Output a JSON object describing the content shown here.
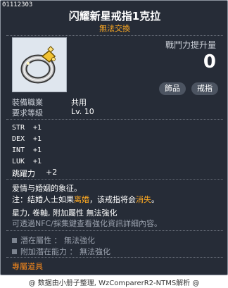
{
  "item": {
    "id": "01112303",
    "name": "闪耀新星戒指1克拉",
    "trade": "無法交換",
    "stat_label": "戰鬥力提升量",
    "stat_value": "0",
    "tags": [
      "飾品",
      "戒指"
    ]
  },
  "requirements": [
    {
      "label": "裝備職業",
      "value": "共用"
    },
    {
      "label": "要求等級",
      "value": "Lv. 10"
    }
  ],
  "stats": [
    {
      "name": "STR",
      "value": "+1"
    },
    {
      "name": "DEX",
      "value": "+1"
    },
    {
      "name": "INT",
      "value": "+1"
    },
    {
      "name": "LUK",
      "value": "+1"
    }
  ],
  "jump": {
    "name": "跳躍力",
    "value": "+2"
  },
  "description": {
    "line1": "爱情与婚姻的象征。",
    "line2_a": "注：结婚人士如果",
    "line2_hl1": "离婚",
    "line2_b": "，该戒指将会",
    "line2_hl2": "消失",
    "line2_c": "。",
    "line3": "星力, 卷軸, 附加屬性 無法強化",
    "line4": "可透過NFC/採集鍵查看強化資訊詳細內容。"
  },
  "potential": [
    {
      "label": "潛在屬性 ： 無法強化"
    },
    {
      "label": "附加潛在能力 ： 無法強化"
    }
  ],
  "special": "專屬道具",
  "footer": "@ 数据由小册子整理, WzComparerR2-NTMS解析 @",
  "colors": {
    "panel": "#262c37",
    "highlight": "#ffaa22",
    "special": "#ff8c1a"
  }
}
